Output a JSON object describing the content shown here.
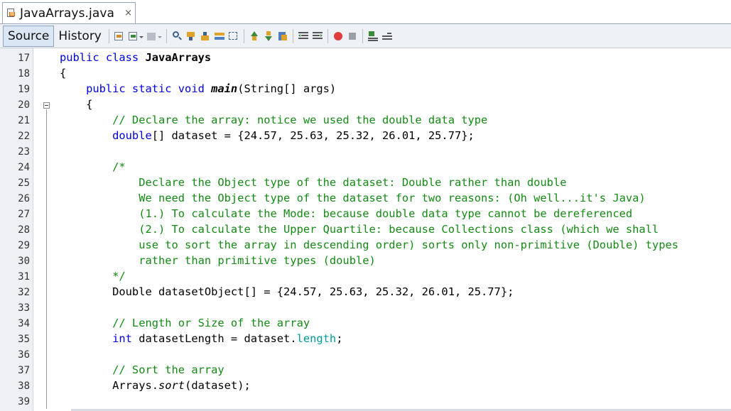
{
  "tab": {
    "title": "JavaArrays.java",
    "close": "×"
  },
  "toolbar": {
    "source_label": "Source",
    "history_label": "History"
  },
  "editor": {
    "line_numbers": [
      "17",
      "18",
      "19",
      "20",
      "21",
      "22",
      "23",
      "24",
      "25",
      "26",
      "27",
      "28",
      "29",
      "30",
      "31",
      "32",
      "33",
      "34",
      "35",
      "36",
      "37",
      "38",
      "39"
    ],
    "lines": {
      "l17_kw": "public class ",
      "l17_cls": "JavaArrays",
      "l18": "{",
      "l19_kw": "    public static void ",
      "l19_mth": "main",
      "l19_rest": "(String[] args)",
      "l20": "    {",
      "l21": "        // Declare the array: notice we used the double data type",
      "l22_kw": "        double",
      "l22_rest": "[] dataset = {24.57, 25.63, 25.32, 26.01, 25.77};",
      "l24": "        /*",
      "l25": "            Declare the Object type of the dataset: Double rather than double",
      "l26": "            We need the Object type of the dataset for two reasons: (Oh well...it's Java)",
      "l27": "            (1.) To calculate the Mode: because double data type cannot be dereferenced",
      "l28": "            (2.) To calculate the Upper Quartile: because Collections class (which we shall",
      "l29": "            use to sort the array in descending order) sorts only non-primitive (Double) types",
      "l30": "            rather than primitive types (double)",
      "l31": "        */",
      "l32": "        Double datasetObject[] = {24.57, 25.63, 25.32, 26.01, 25.77};",
      "l34": "        // Length or Size of the array",
      "l35_kw": "        int",
      "l35_mid": " datasetLength = dataset.",
      "l35_fld": "length",
      "l35_end": ";",
      "l37": "        // Sort the array",
      "l38_a": "        Arrays.",
      "l38_it": "sort",
      "l38_b": "(dataset);"
    }
  }
}
